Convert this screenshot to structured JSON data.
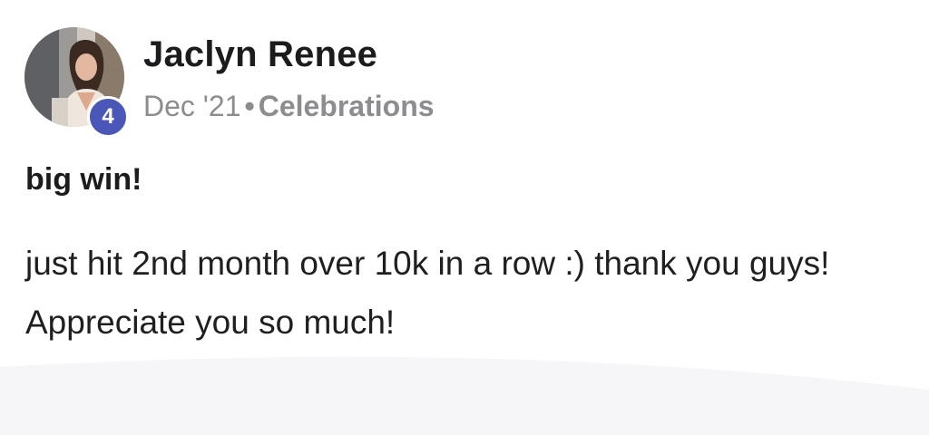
{
  "author": {
    "name": "Jaclyn Renee",
    "level": "4"
  },
  "meta": {
    "date": "Dec '21",
    "separator": "•",
    "category": "Celebrations"
  },
  "post": {
    "title": "big win!",
    "body": "just hit 2nd month over 10k in a row :) thank you guys! Appreciate you so much!"
  },
  "colors": {
    "level_badge": "#4a56b8",
    "meta_text": "#8d8d91",
    "body_text": "#1f1f22"
  }
}
